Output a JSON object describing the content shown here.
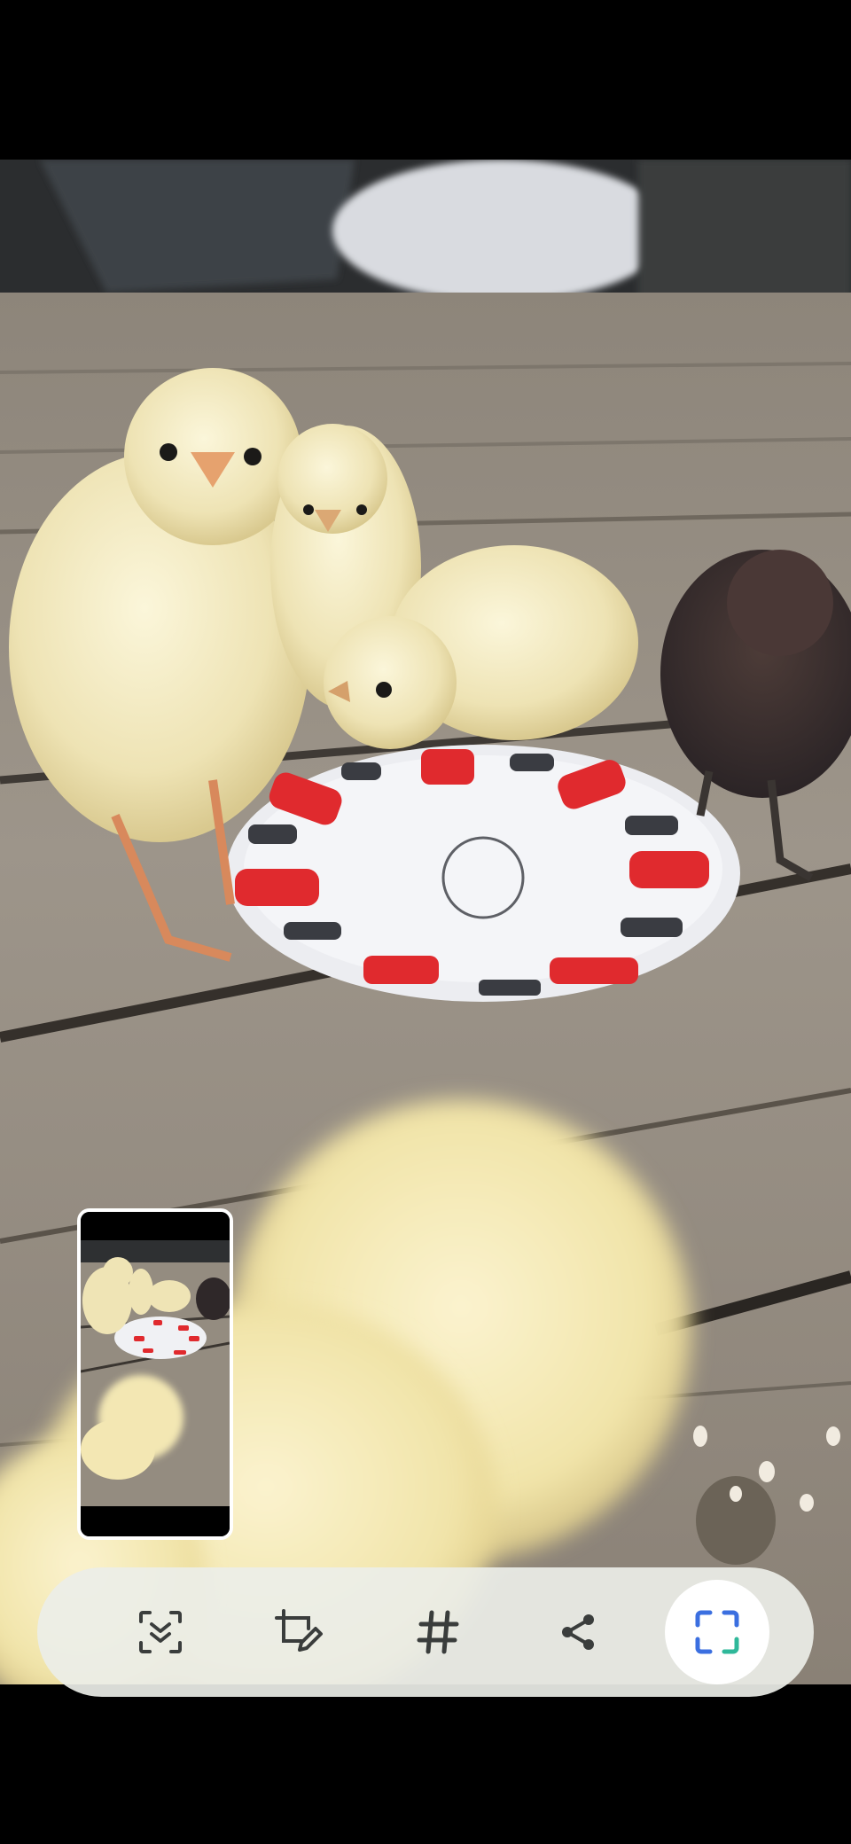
{
  "toolbar": {
    "buttons": [
      {
        "icon": "scroll-capture-icon",
        "active": false
      },
      {
        "icon": "draw-edit-icon",
        "active": false
      },
      {
        "icon": "hashtag-icon",
        "active": false
      },
      {
        "icon": "share-icon",
        "active": false
      },
      {
        "icon": "crop-frame-icon",
        "active": true
      }
    ]
  },
  "colors": {
    "toolbar_bg": "#eceee8",
    "icon_dark": "#3a3d3c",
    "active_bg": "#ffffff",
    "accent_blue": "#3b6fe0",
    "accent_green": "#2fb89a"
  }
}
